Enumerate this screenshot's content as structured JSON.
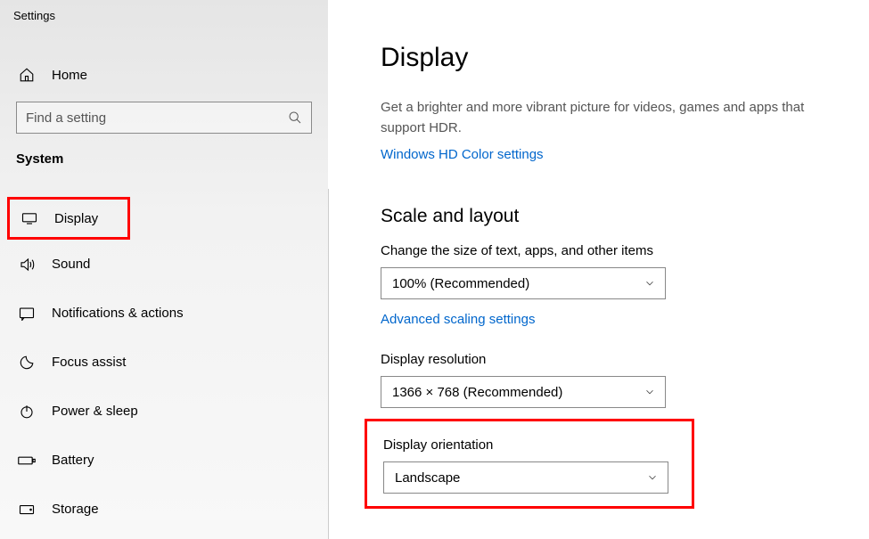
{
  "window_title": "Settings",
  "home_label": "Home",
  "search_placeholder": "Find a setting",
  "category": "System",
  "nav": {
    "display": "Display",
    "sound": "Sound",
    "notifications": "Notifications & actions",
    "focus": "Focus assist",
    "power": "Power & sleep",
    "battery": "Battery",
    "storage": "Storage"
  },
  "main": {
    "title": "Display",
    "hdr_desc": "Get a brighter and more vibrant picture for videos, games and apps that support HDR.",
    "hdr_link": "Windows HD Color settings",
    "scale_heading": "Scale and layout",
    "scale_label": "Change the size of text, apps, and other items",
    "scale_value": "100% (Recommended)",
    "adv_scaling": "Advanced scaling settings",
    "res_label": "Display resolution",
    "res_value": "1366 × 768 (Recommended)",
    "orient_label": "Display orientation",
    "orient_value": "Landscape"
  }
}
